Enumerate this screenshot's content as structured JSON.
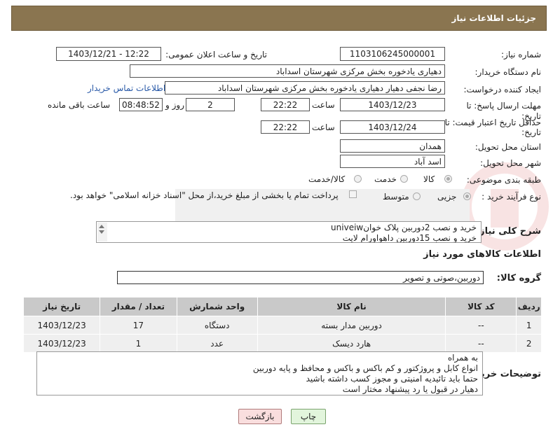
{
  "header": {
    "title": "جزئیات اطلاعات نیاز"
  },
  "fields": {
    "need_number_label": "شماره نیاز:",
    "need_number": "1103106245000001",
    "announce_label": "تاریخ و ساعت اعلان عمومی:",
    "announce_value": "1403/12/21 - 12:22",
    "buyer_org_label": "نام دستگاه خریدار:",
    "buyer_org": "دهیاری یادخوره بخش مرکزی شهرستان اسداباد",
    "creator_label": "ایجاد کننده درخواست:",
    "creator": "رضا نجفی دهیار دهیاری یادخوره بخش مرکزی شهرستان اسداباد",
    "contact_link": "اطلاعات تماس خریدار",
    "deadline_label_1": "مهلت ارسال پاسخ: تا",
    "deadline_label_2": "تاریخ:",
    "deadline_date": "1403/12/23",
    "time_label": "ساعت",
    "deadline_time": "22:22",
    "days_value": "2",
    "days_label": "روز و",
    "remaining_time": "08:48:52",
    "remaining_label": "ساعت باقی مانده",
    "validity_label_1": "حداقل تاریخ اعتبار قیمت: تا",
    "validity_label_2": "تاریخ:",
    "validity_date": "1403/12/24",
    "validity_time": "22:22",
    "province_label": "استان محل تحویل:",
    "province": "همدان",
    "city_label": "شهر محل تحویل:",
    "city": "اسد آباد",
    "category_label": "طبقه بندی موضوعی:",
    "category_options": [
      "کالا",
      "خدمت",
      "کالا/خدمت"
    ],
    "process_label": "نوع فرآیند خرید :",
    "process_options": [
      "جزیی",
      "متوسط"
    ],
    "payment_note": "پرداخت تمام یا بخشی از مبلغ خرید،از محل \"اسناد خزانه اسلامی\" خواهد بود."
  },
  "description": {
    "label": "شرح کلی نیاز:",
    "line1": "خرید و نصب 2دوربین پلاک خوانuniveiw",
    "line2": "خرید و نصب 15دوربین داهواورام لایت"
  },
  "goods_info": {
    "title": "اطلاعات کالاهای مورد نیاز",
    "group_label": "گروه کالا:",
    "group_value": "دوربین،صوتی و تصویر"
  },
  "table": {
    "headers": [
      "ردیف",
      "کد کالا",
      "نام کالا",
      "واحد شمارش",
      "تعداد / مقدار",
      "تاریخ نیاز"
    ],
    "rows": [
      [
        "1",
        "--",
        "دوربین مدار بسته",
        "دستگاه",
        "17",
        "1403/12/23"
      ],
      [
        "2",
        "--",
        "هارد دیسک",
        "عدد",
        "1",
        "1403/12/23"
      ]
    ]
  },
  "buyer_notes": {
    "label": "توضیحات خریدار:",
    "lines": [
      "به همراه",
      "انواع کابل و پروژکتور و کم باکس و باکس و محافظ و پایه دوربین",
      "حتما باید تائیدیه امنیتی و مجوز کسب داشته باشید",
      "دهیار در قبول یا رد پیشنهاد مختار است"
    ]
  },
  "buttons": {
    "print": "چاپ",
    "back": "بازگشت"
  },
  "colors": {
    "header_bg": "#8a7550",
    "link": "#2a5aa8",
    "back_btn": "#f9dede",
    "print_btn": "#e2f5dc"
  },
  "watermark_icon": "ariatender-logo-icon"
}
